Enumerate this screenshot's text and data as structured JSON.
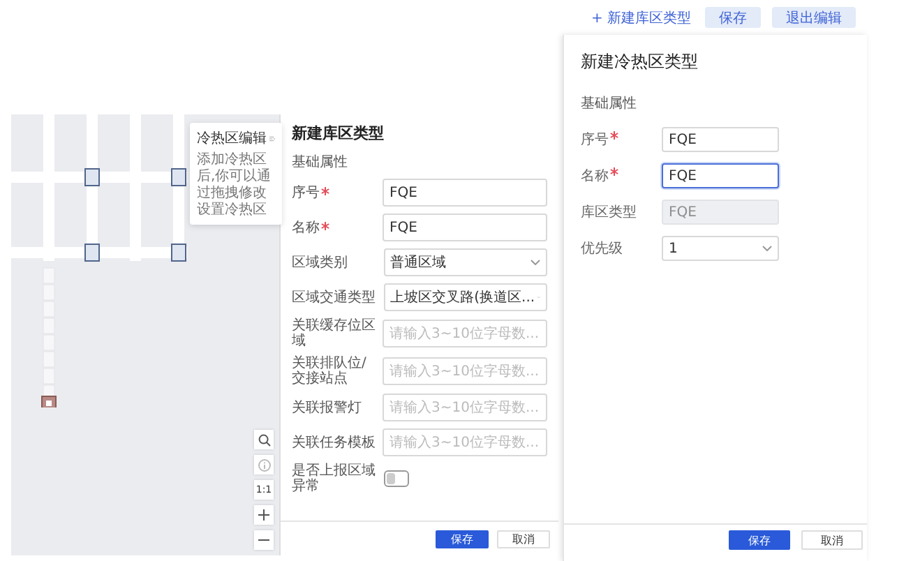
{
  "toolbar": {
    "new_button": "+ 新建库区类型",
    "save_button": "保存",
    "exit_button": "退出编辑"
  },
  "map": {
    "tooltip": {
      "title": "冷热区编辑",
      "text": "添加冷热区后,你可以通过拖拽修改设置冷热区"
    },
    "zoom_reset": "1:1"
  },
  "zone_panel": {
    "title": "新建库区类型",
    "section": "基础属性",
    "fields": [
      {
        "kind": "input",
        "label": "序号",
        "required": true,
        "value": "FQE"
      },
      {
        "kind": "input",
        "label": "名称",
        "required": true,
        "value": "FQE"
      },
      {
        "kind": "select",
        "label": "区域类别",
        "required": false,
        "value": "普通区域"
      },
      {
        "kind": "select",
        "label": "区域交通类型",
        "required": false,
        "value": "上坡区交叉路(换道区..."
      },
      {
        "kind": "input",
        "label": "关联缓存位区域",
        "required": false,
        "placeholder": "请输入3~10位字母数..."
      },
      {
        "kind": "input",
        "label": "关联排队位/交接站点",
        "required": false,
        "placeholder": "请输入3~10位字母数..."
      },
      {
        "kind": "input",
        "label": "关联报警灯",
        "required": false,
        "placeholder": "请输入3~10位字母数..."
      },
      {
        "kind": "input",
        "label": "关联任务模板",
        "required": false,
        "placeholder": "请输入3~10位字母数..."
      },
      {
        "kind": "toggle",
        "label": "是否上报区域异常",
        "required": false,
        "on": false
      }
    ],
    "buttons": [
      {
        "label": "保存",
        "primary": true
      },
      {
        "label": "取消",
        "primary": false
      }
    ]
  },
  "heat_panel": {
    "title": "新建冷热区类型",
    "section": "基础属性",
    "fields": [
      {
        "kind": "input",
        "label": "序号",
        "required": true,
        "value": "FQE",
        "focused": false,
        "disabled": false
      },
      {
        "kind": "input",
        "label": "名称",
        "required": true,
        "value": "FQE",
        "focused": true,
        "disabled": false
      },
      {
        "kind": "input",
        "label": "库区类型",
        "required": false,
        "value": "FQE",
        "focused": false,
        "disabled": true
      },
      {
        "kind": "select",
        "label": "优先级",
        "required": false,
        "value": "1",
        "focused": false,
        "disabled": false
      }
    ],
    "buttons": [
      {
        "label": "保存",
        "primary": true
      },
      {
        "label": "取消",
        "primary": false
      }
    ]
  }
}
